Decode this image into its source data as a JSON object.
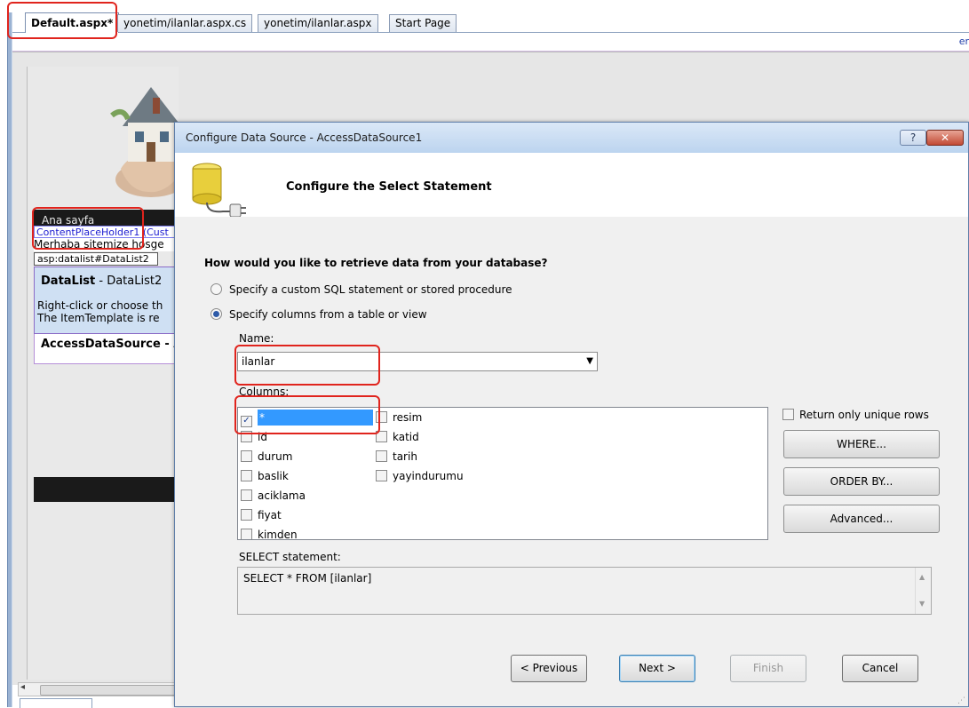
{
  "ide": {
    "tabs": [
      {
        "label": "Default.aspx*",
        "active": true
      },
      {
        "label": "yonetim/ilanlar.aspx.cs",
        "active": false
      },
      {
        "label": "yonetim/ilanlar.aspx",
        "active": false
      },
      {
        "label": "Start Page",
        "active": false
      }
    ],
    "toolbar_right_text": "er",
    "design": {
      "nav_text": "Ana sayfa",
      "content_placeholder_label": "ContentPlaceHolder1 (Cust",
      "welcome_text": "Merhaba sitemize hosge",
      "datalist_tag": "asp:datalist#DataList2",
      "datalist_title_bold": "DataList",
      "datalist_title_rest": " - DataList2",
      "datalist_desc_line1": "Right-click or choose th",
      "datalist_desc_line2": "The ItemTemplate is re",
      "access_datasource_label": "AccessDataSource - A"
    },
    "scroll_left_arrow": "◂"
  },
  "dialog": {
    "title": "Configure Data Source - AccessDataSource1",
    "help_button": "?",
    "close_button": "✕",
    "heading": "Configure the Select Statement",
    "question": "How would you like to retrieve data from your database?",
    "options": [
      {
        "label": "Specify a custom SQL statement or stored procedure",
        "selected": false
      },
      {
        "label": "Specify columns from a table or view",
        "selected": true
      }
    ],
    "name_label": "Name:",
    "name_value": "ilanlar",
    "columns_label": "Columns:",
    "columns_left": [
      {
        "label": "*",
        "checked": true,
        "selected": true
      },
      {
        "label": "id",
        "checked": false
      },
      {
        "label": "durum",
        "checked": false
      },
      {
        "label": "baslik",
        "checked": false
      },
      {
        "label": "aciklama",
        "checked": false
      },
      {
        "label": "fiyat",
        "checked": false
      },
      {
        "label": "kimden",
        "checked": false
      }
    ],
    "columns_right": [
      {
        "label": "resim",
        "checked": false
      },
      {
        "label": "katid",
        "checked": false
      },
      {
        "label": "tarih",
        "checked": false
      },
      {
        "label": "yayindurumu",
        "checked": false
      }
    ],
    "unique_rows_label": "Return only unique rows",
    "where_button": "WHERE...",
    "orderby_button": "ORDER BY...",
    "advanced_button": "Advanced...",
    "sql_label": "SELECT statement:",
    "sql_text": "SELECT * FROM [ilanlar]",
    "buttons": {
      "previous": "< Previous",
      "next": "Next >",
      "finish": "Finish",
      "cancel": "Cancel"
    }
  },
  "colors": {
    "accent_blue": "#3399ff",
    "annotation_red": "#e0241d",
    "titlebar": "#bcd4ef"
  }
}
